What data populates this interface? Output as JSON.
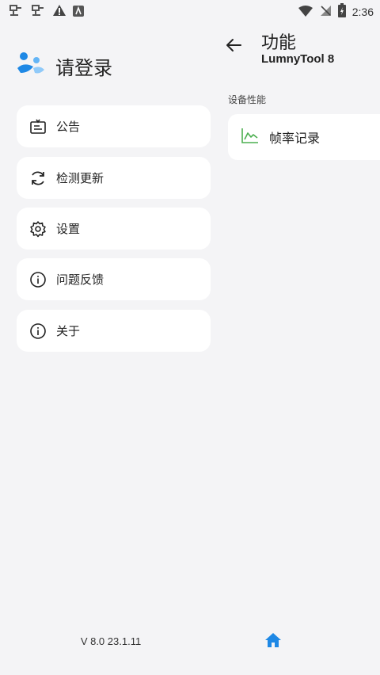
{
  "status_bar": {
    "time": "2:36",
    "left_icons": [
      "bug-icon",
      "bug-icon",
      "warning-icon",
      "android-icon"
    ],
    "right_icons": [
      "wifi-icon",
      "no-signal-icon",
      "battery-charging-icon"
    ]
  },
  "drawer": {
    "profile": {
      "name": "请登录"
    },
    "menu": [
      {
        "label": "公告",
        "icon": "announcement-icon"
      },
      {
        "label": "检测更新",
        "icon": "refresh-icon"
      },
      {
        "label": "设置",
        "icon": "gear-icon"
      },
      {
        "label": "问题反馈",
        "icon": "info-icon"
      },
      {
        "label": "关于",
        "icon": "info-icon"
      }
    ],
    "version": "V 8.0 23.1.11"
  },
  "panel": {
    "title": "功能",
    "subtitle": "LumnyTool 8",
    "section_label": "设备性能",
    "feature": {
      "label": "帧率记录",
      "icon": "chart-line-icon"
    }
  },
  "colors": {
    "accent": "#1e88e5",
    "chart_icon": "#4caf50",
    "background": "#f4f4f6"
  }
}
